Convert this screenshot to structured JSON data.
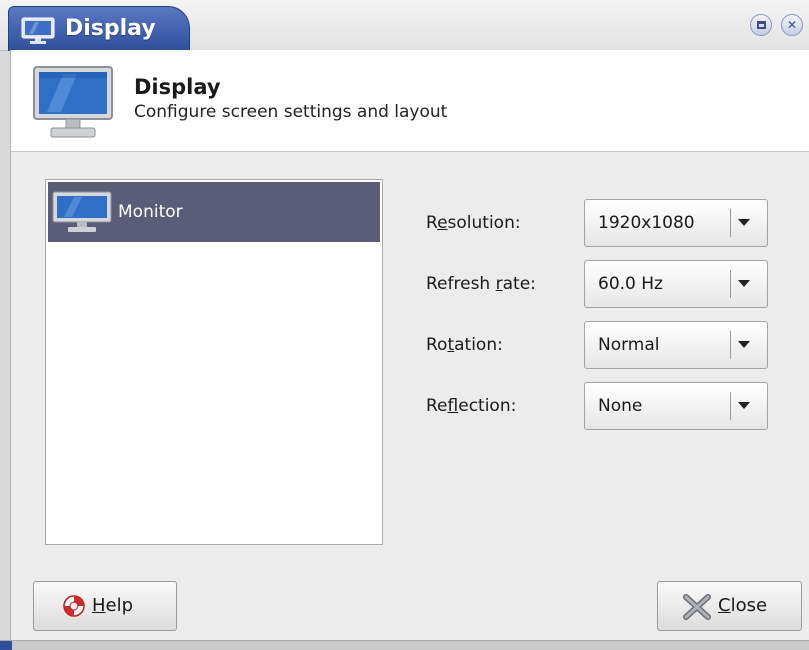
{
  "window": {
    "title": "Display",
    "maximize_icon": "maximize-icon",
    "close_icon": "close-icon",
    "accent_color": "#2f4f9c"
  },
  "header": {
    "icon": "monitor-icon",
    "title": "Display",
    "subtitle": "Configure screen settings and layout"
  },
  "monitors": [
    {
      "label": "Monitor",
      "icon": "monitor-icon",
      "selected": true
    }
  ],
  "settings": {
    "resolution": {
      "pre": "R",
      "mnemonic": "e",
      "post": "solution:",
      "value": "1920x1080"
    },
    "refresh_rate": {
      "pre": "Refresh ",
      "mnemonic": "r",
      "post": "ate:",
      "value": "60.0 Hz"
    },
    "rotation": {
      "pre": "Ro",
      "mnemonic": "t",
      "post": "ation:",
      "value": "Normal"
    },
    "reflection": {
      "pre": "Re",
      "mnemonic": "f",
      "post": "lection:",
      "value": "None"
    }
  },
  "buttons": {
    "help": {
      "mnemonic": "H",
      "rest": "elp",
      "icon": "lifebuoy-icon"
    },
    "close": {
      "mnemonic": "C",
      "rest": "lose",
      "icon": "close-x-icon"
    }
  }
}
